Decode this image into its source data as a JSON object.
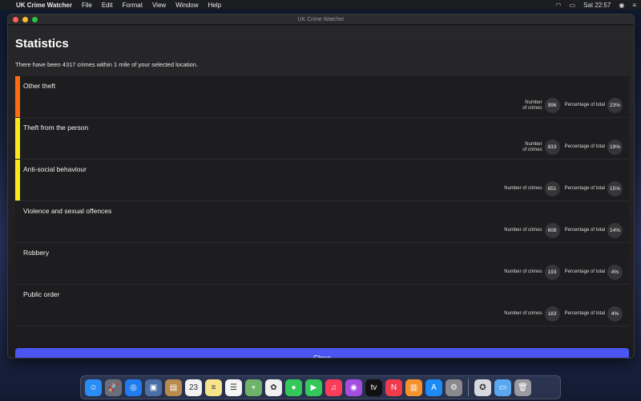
{
  "menubar": {
    "app_name": "UK Crime Watcher",
    "items": [
      "File",
      "Edit",
      "Format",
      "View",
      "Window",
      "Help"
    ],
    "clock": "Sat 22:57"
  },
  "window": {
    "title": "UK Crime Watcher"
  },
  "stats": {
    "title": "Statistics",
    "summary": "There have been 4317 crimes within 1 mile of your selected location.",
    "number_label": "Number of crimes",
    "percent_label": "Percentage of total",
    "rows": [
      {
        "name": "Other theft",
        "count": "996",
        "percent": "23%",
        "color": "#ff6a13",
        "wrap": true
      },
      {
        "name": "Theft from the person",
        "count": "833",
        "percent": "19%",
        "color": "#ffe81a",
        "wrap": true
      },
      {
        "name": "Anti-social behaviour",
        "count": "651",
        "percent": "15%",
        "color": "#ffe81a",
        "wrap": false
      },
      {
        "name": "Violence and sexual offences",
        "count": "608",
        "percent": "14%",
        "color": "",
        "wrap": false
      },
      {
        "name": "Robbery",
        "count": "193",
        "percent": "4%",
        "color": "",
        "wrap": false
      },
      {
        "name": "Public order",
        "count": "183",
        "percent": "4%",
        "color": "",
        "wrap": false
      }
    ]
  },
  "close_label": "Close",
  "dock": {
    "apps": [
      {
        "name": "finder-icon",
        "glyph": "☺",
        "color": "#2a8cf5"
      },
      {
        "name": "launchpad-icon",
        "glyph": "🚀",
        "color": "#6b6f7a"
      },
      {
        "name": "safari-icon",
        "glyph": "◎",
        "color": "#1e7cf0"
      },
      {
        "name": "photo-preview-icon",
        "glyph": "▣",
        "color": "#4a6fa5"
      },
      {
        "name": "contacts-icon",
        "glyph": "▤",
        "color": "#b78a4e"
      },
      {
        "name": "calendar-icon",
        "glyph": "23",
        "color": "#f2f2f2"
      },
      {
        "name": "notes-icon",
        "glyph": "≡",
        "color": "#f7e38a"
      },
      {
        "name": "reminders-icon",
        "glyph": "☰",
        "color": "#f5f5f5"
      },
      {
        "name": "maps-icon",
        "glyph": "⌖",
        "color": "#6fb36a"
      },
      {
        "name": "photos-icon",
        "glyph": "✿",
        "color": "#f0f0f0"
      },
      {
        "name": "messages-icon",
        "glyph": "●",
        "color": "#35c759"
      },
      {
        "name": "facetime-icon",
        "glyph": "▶",
        "color": "#34c759"
      },
      {
        "name": "music-icon",
        "glyph": "♫",
        "color": "#fb3c5a"
      },
      {
        "name": "podcasts-icon",
        "glyph": "◉",
        "color": "#a44de0"
      },
      {
        "name": "tv-icon",
        "glyph": "tv",
        "color": "#111111"
      },
      {
        "name": "news-icon",
        "glyph": "N",
        "color": "#f03b4d"
      },
      {
        "name": "books-icon",
        "glyph": "▥",
        "color": "#f7922b"
      },
      {
        "name": "app-store-icon",
        "glyph": "A",
        "color": "#1d8bf5"
      },
      {
        "name": "system-preferences-icon",
        "glyph": "⚙",
        "color": "#8a8a8e"
      }
    ],
    "extras": [
      {
        "name": "crime-watcher-app-icon",
        "glyph": "✪",
        "color": "#d8d8e0"
      },
      {
        "name": "folder-icon",
        "glyph": "▭",
        "color": "#5aa8f0"
      },
      {
        "name": "trash-icon",
        "glyph": "🗑",
        "color": "#9a9aa0"
      }
    ]
  }
}
